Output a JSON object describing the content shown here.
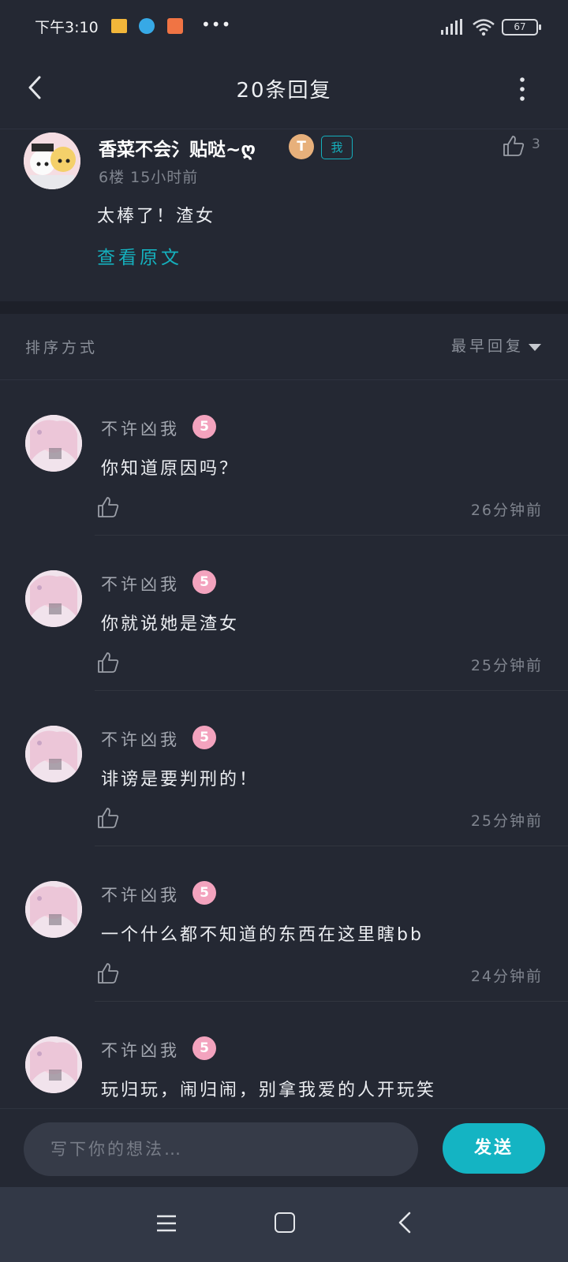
{
  "status_bar": {
    "time": "下午3:10",
    "battery": "67",
    "icons": [
      "note-icon",
      "bird-icon",
      "mail-icon",
      "more-icon",
      "signal-icon",
      "wifi-icon",
      "battery-icon"
    ]
  },
  "header": {
    "title": "20条回复",
    "back_icon": "chevron-left-icon",
    "more_icon": "vertical-dots-icon"
  },
  "post": {
    "username": "香菜不会氵贴哒~ღ",
    "level_icon": "T",
    "badge": "我",
    "meta": "6楼  15小时前",
    "likes": "3",
    "content": "太棒了！渣女",
    "view_original": "查看原文"
  },
  "sort": {
    "label": "排序方式",
    "value": "最早回复"
  },
  "replies": [
    {
      "username": "不许凶我",
      "level": "5",
      "content": "你知道原因吗？",
      "time": "26分钟前"
    },
    {
      "username": "不许凶我",
      "level": "5",
      "content": "你就说她是渣女",
      "time": "25分钟前"
    },
    {
      "username": "不许凶我",
      "level": "5",
      "content": "诽谤是要判刑的！",
      "time": "25分钟前"
    },
    {
      "username": "不许凶我",
      "level": "5",
      "content": "一个什么都不知道的东西在这里瞎bb",
      "time": "24分钟前"
    },
    {
      "username": "不许凶我",
      "level": "5",
      "content": "玩归玩，闹归闹，别拿我爱的人开玩笑",
      "time": ""
    }
  ],
  "input": {
    "placeholder": "写下你的想法…",
    "send_label": "发送"
  },
  "colors": {
    "background": "#242833",
    "accent": "#14b4c3",
    "nav_bar": "#323846"
  }
}
